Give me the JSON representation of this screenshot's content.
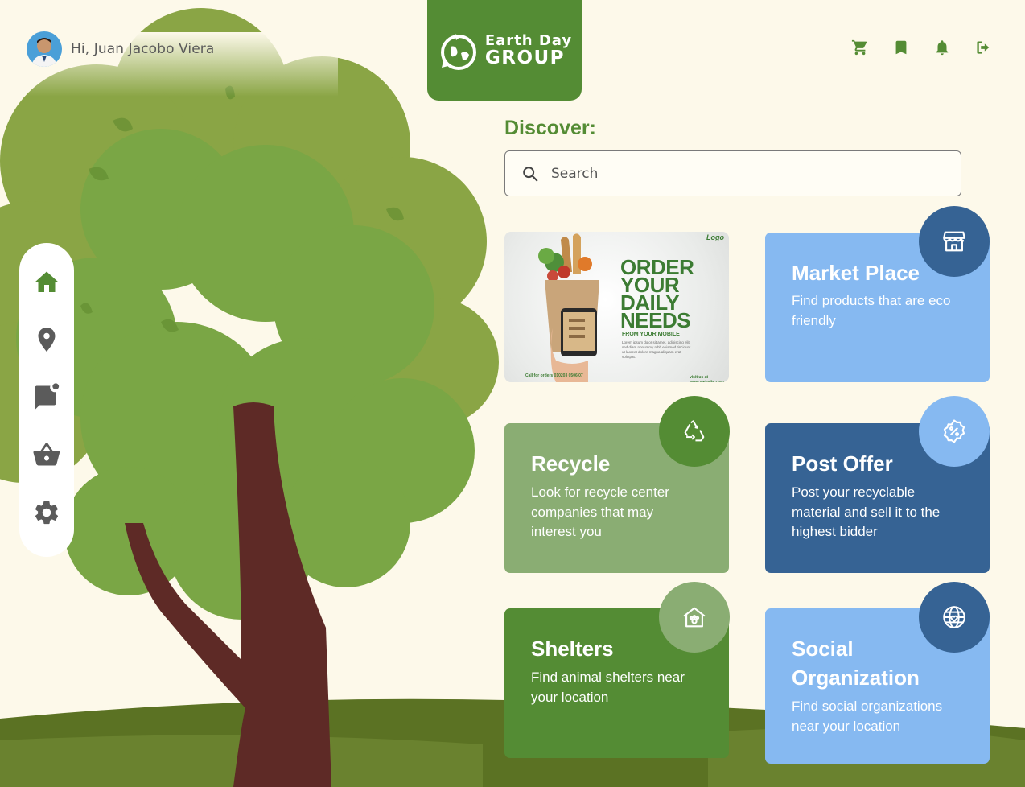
{
  "user": {
    "greeting": "Hi, Juan Jacobo Viera"
  },
  "brand": {
    "line1": "Earth Day",
    "line2": "GROUP"
  },
  "header_icons": [
    "cart-icon",
    "bookmark-icon",
    "bell-icon",
    "logout-icon"
  ],
  "sidebar": {
    "items": [
      "home-icon",
      "location-pin-icon",
      "message-icon",
      "basket-icon",
      "gear-icon"
    ],
    "active": "home-icon"
  },
  "discover": {
    "label": "Discover:"
  },
  "search": {
    "placeholder": "Search"
  },
  "promo": {
    "title": "ORDER YOUR DAILY NEEDS",
    "subtitle": "FROM YOUR MOBILE",
    "body": "Lorem ipsum dolor sit amet, adipiscing elit, sed diam nonummy nibh euismod tincidunt ut laoreet dolore magna aliquam erat volutpat.",
    "call": "Call for orders 010203 0506 07",
    "visit": "visit us at www.website.com",
    "logo": "Logo"
  },
  "cards": {
    "market": {
      "title": "Market Place",
      "desc": "Find products that are eco friendly",
      "icon": "storefront-icon"
    },
    "recycle": {
      "title": "Recycle",
      "desc": "Look for recycle center companies that may interest you",
      "icon": "recycle-icon"
    },
    "post_offer": {
      "title": "Post Offer",
      "desc": "Post your recyclable material and sell it to the highest bidder",
      "icon": "discount-badge-icon"
    },
    "shelters": {
      "title": "Shelters",
      "desc": "Find animal shelters near your location",
      "icon": "pet-house-icon"
    },
    "social": {
      "title": "Social Organization",
      "desc": "Find social organizations near your location",
      "icon": "globe-heart-icon"
    }
  },
  "colors": {
    "background": "#fdf9ea",
    "brand_green": "#548c34",
    "light_green": "#8aad73",
    "dark_blue": "#366394",
    "light_blue": "#86b9f1",
    "trunk": "#5e2a26"
  }
}
